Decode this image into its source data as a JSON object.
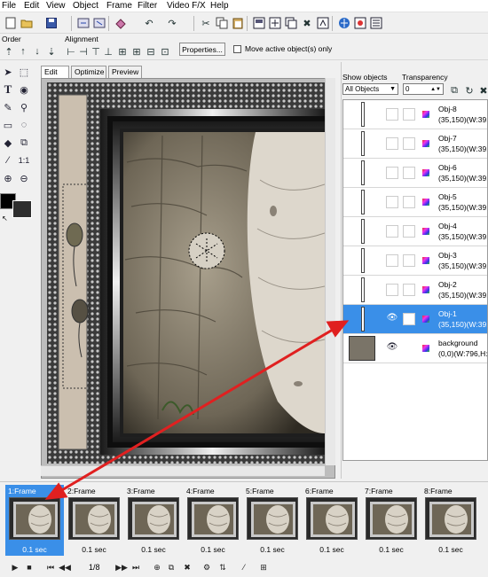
{
  "menu": [
    "File",
    "Edit",
    "View",
    "Object",
    "Frame",
    "Filter",
    "Video F/X",
    "Help"
  ],
  "toolbar2": {
    "order_label": "Order",
    "alignment_label": "Alignment",
    "properties_button": "Properties...",
    "move_active_label": "Move active object(s) only"
  },
  "tabs": [
    "Edit",
    "Optimize",
    "Preview"
  ],
  "panel": {
    "show_objects_label": "Show objects",
    "transparency_label": "Transparency",
    "show_objects_value": "All Objects",
    "transparency_value": "0"
  },
  "objects": [
    {
      "name": "Obj-8",
      "info": "(35,150)(W:39,"
    },
    {
      "name": "Obj-7",
      "info": "(35,150)(W:39,"
    },
    {
      "name": "Obj-6",
      "info": "(35,150)(W:39,"
    },
    {
      "name": "Obj-5",
      "info": "(35,150)(W:39,"
    },
    {
      "name": "Obj-4",
      "info": "(35,150)(W:39,"
    },
    {
      "name": "Obj-3",
      "info": "(35,150)(W:39,"
    },
    {
      "name": "Obj-2",
      "info": "(35,150)(W:39,"
    },
    {
      "name": "Obj-1",
      "info": "(35,150)(W:39,"
    },
    {
      "name": "background",
      "info": "(0,0)(W:796,H:"
    }
  ],
  "selected_object": "Obj-1",
  "frames": [
    {
      "label": "1:Frame",
      "time": "0.1 sec"
    },
    {
      "label": "2:Frame",
      "time": "0.1 sec"
    },
    {
      "label": "3:Frame",
      "time": "0.1 sec"
    },
    {
      "label": "4:Frame",
      "time": "0.1 sec"
    },
    {
      "label": "5:Frame",
      "time": "0.1 sec"
    },
    {
      "label": "6:Frame",
      "time": "0.1 sec"
    },
    {
      "label": "7:Frame",
      "time": "0.1 sec"
    },
    {
      "label": "8:Frame",
      "time": "0.1 sec"
    }
  ],
  "selected_frame": "1:Frame",
  "frame_counter": "1/8",
  "colors": {
    "selection": "#3a8fe8",
    "arrow": "#e02020",
    "background_swatch": "#2e2e2e",
    "foreground_swatch": "#000000"
  }
}
